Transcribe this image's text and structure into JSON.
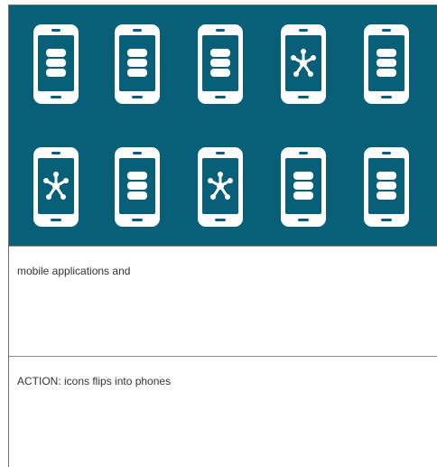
{
  "colors": {
    "banner": "#085f78",
    "icon": "#ffffff"
  },
  "phones": [
    [
      {
        "icon": "database-icon"
      },
      {
        "icon": "database-icon"
      },
      {
        "icon": "database-icon"
      },
      {
        "icon": "network-hub-icon"
      },
      {
        "icon": "database-icon"
      }
    ],
    [
      {
        "icon": "network-hub-icon"
      },
      {
        "icon": "database-icon"
      },
      {
        "icon": "network-hub-icon"
      },
      {
        "icon": "database-icon"
      },
      {
        "icon": "database-icon"
      }
    ]
  ],
  "captions": {
    "first": "mobile applications and",
    "second": "ACTION: icons flips into phones"
  }
}
